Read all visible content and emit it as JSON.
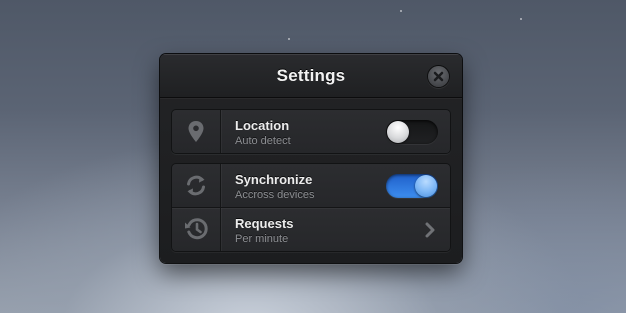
{
  "window": {
    "title": "Settings",
    "close_icon": "close-icon"
  },
  "settings": {
    "location": {
      "icon": "location-pin-icon",
      "label": "Location",
      "sublabel": "Auto detect",
      "enabled": false
    },
    "synchronize": {
      "icon": "sync-icon",
      "label": "Synchronize",
      "sublabel": "Accross devices",
      "enabled": true
    },
    "requests": {
      "icon": "history-icon",
      "label": "Requests",
      "sublabel": "Per minute",
      "action_icon": "chevron-right-icon"
    }
  },
  "colors": {
    "toggle_on": "#3d8ef0",
    "panel_bg": "#1f2022"
  }
}
